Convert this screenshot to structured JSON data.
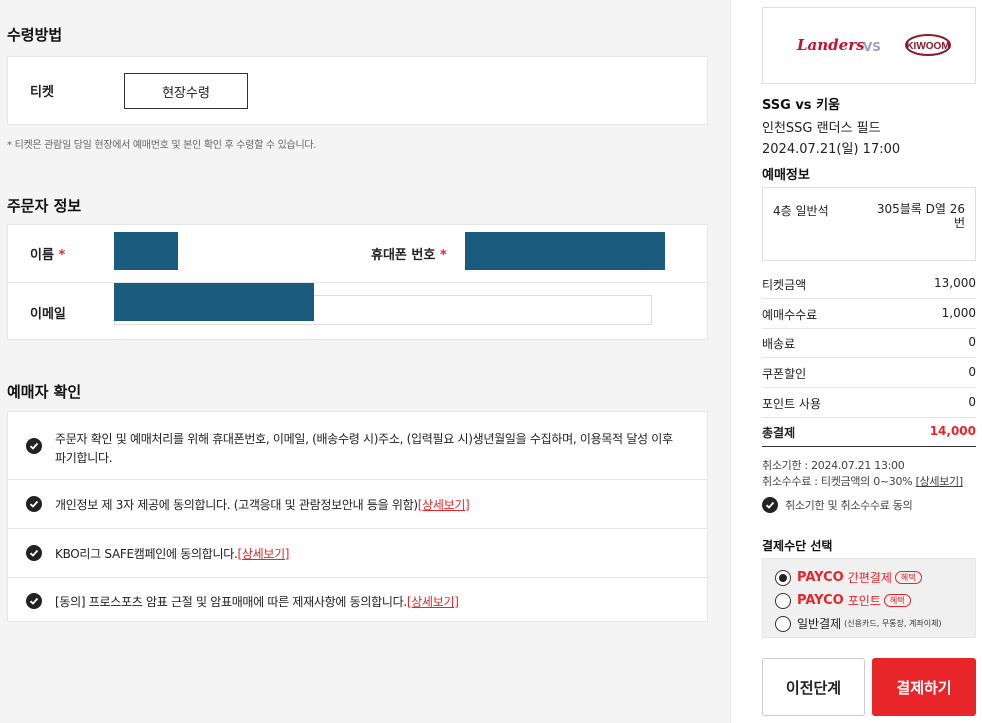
{
  "receipt": {
    "title": "수령방법",
    "ticket_label": "티켓",
    "option": "현장수령",
    "note": "* 티켓은 관람일 당일 현장에서 예매번호 및 본인 확인 후 수령할 수 있습니다."
  },
  "orderer": {
    "title": "주문자 정보",
    "name_label": "이름",
    "phone_label": "휴대폰 번호",
    "email_label": "이메일",
    "required_mark": "*"
  },
  "consent": {
    "title": "예매자 확인",
    "link_text": "[상세보기]",
    "items": [
      {
        "text": "주문자 확인 및 예매처리를 위해 휴대폰번호, 이메일, (배송수령 시)주소, (입력필요 시)생년월일을 수집하며, 이용목적 달성 이후 파기합니다."
      },
      {
        "text": "개인정보 제 3자 제공에 동의합니다. (고객응대 및 관람정보안내 등을 위함)"
      },
      {
        "text": "KBO리그 SAFE캠페인에 동의합니다."
      },
      {
        "text": "[동의] 프로스포츠 암표 근절 및 암표매매에 따른 제재사항에 동의합니다."
      }
    ]
  },
  "match": {
    "home_logo": "Landers",
    "vs": "VS",
    "away_logo": "KIWOOM",
    "title": "SSG vs 키움",
    "venue": "인천SSG 랜더스 필드",
    "datetime": "2024.07.21(일) 17:00"
  },
  "booking": {
    "title": "예매정보",
    "seat_grade": "4층 일반석",
    "seat_no": "305블록 D열 26번"
  },
  "prices": [
    {
      "label": "티켓금액",
      "value": "13,000"
    },
    {
      "label": "예매수수료",
      "value": "1,000"
    },
    {
      "label": "배송료",
      "value": "0"
    },
    {
      "label": "쿠폰할인",
      "value": "0"
    },
    {
      "label": "포인트 사용",
      "value": "0"
    },
    {
      "label": "총결제",
      "value": "14,000"
    }
  ],
  "cancel": {
    "deadline": "취소기한 : 2024.07.21 13:00",
    "fee_prefix": "취소수수료 : 티켓금액의 0~30%",
    "fee_link": "[상세보기]",
    "agree": "취소기한 및 취소수수료 동의"
  },
  "payment": {
    "title": "결제수단 선택",
    "payco": "PAYCO",
    "opt1_label": "간편결제",
    "opt1_badge": "혜택",
    "opt2_label": "포인트",
    "opt2_badge": "혜택",
    "opt3_label": "일반결제",
    "opt3_sub": "(신용카드, 무통장, 계좌이체)"
  },
  "buttons": {
    "prev": "이전단계",
    "pay": "결제하기"
  }
}
